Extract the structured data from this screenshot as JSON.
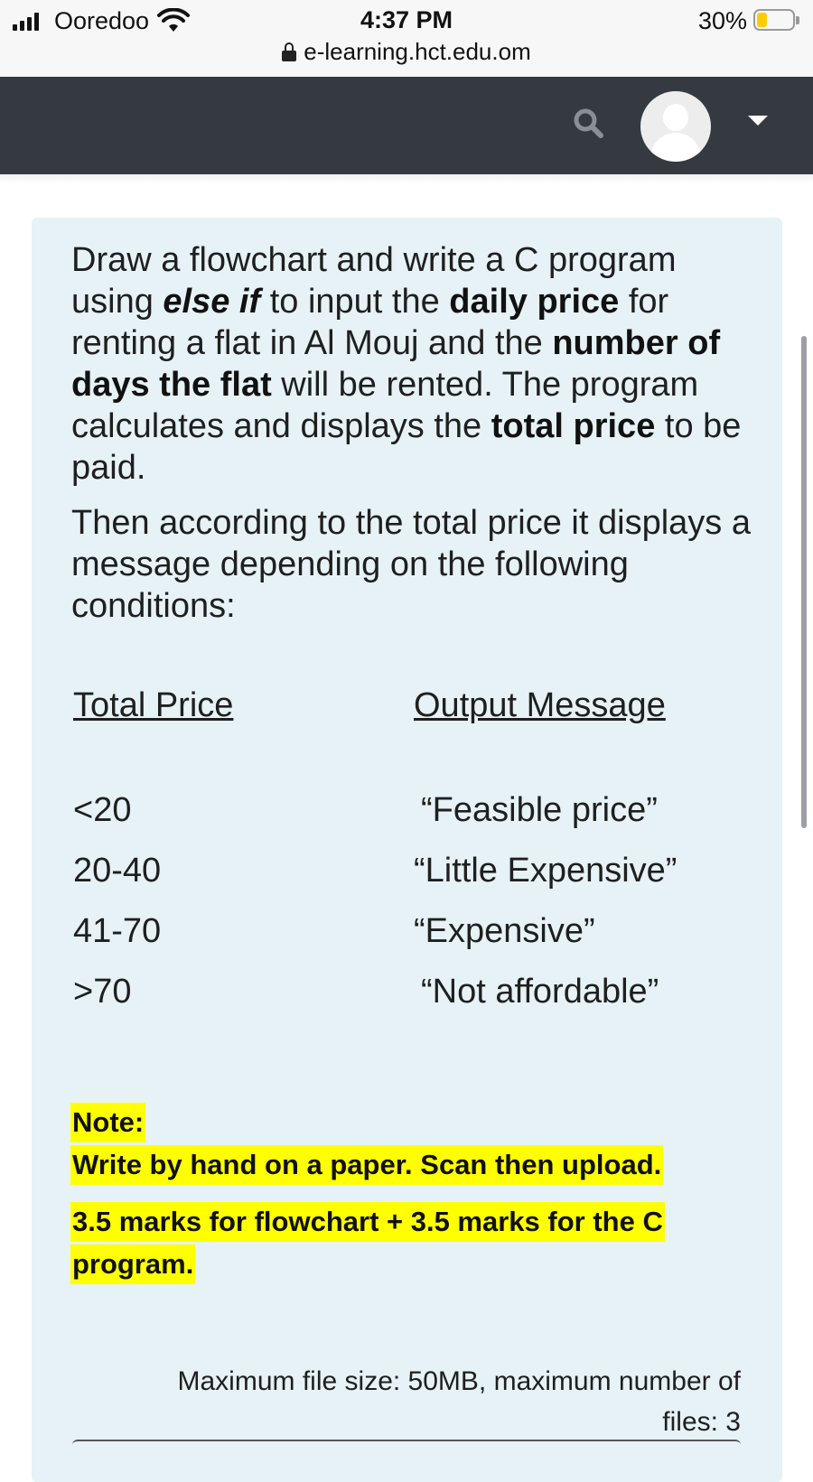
{
  "status_bar": {
    "carrier": "Ooredoo",
    "time": "4:37 PM",
    "battery_percent": "30%",
    "battery_level": 0.3,
    "url": "e-learning.hct.edu.om"
  },
  "navbar": {
    "background": "#343a40",
    "icons": [
      "search-icon",
      "user-avatar",
      "chevron-down-icon"
    ]
  },
  "question": {
    "paragraph1": {
      "t1": "Draw a flowchart and write a C program using ",
      "b1": "else if",
      "t2": " to input the ",
      "b2": "daily price",
      "t3": " for renting a flat in Al Mouj and the ",
      "b3": "number of days the flat",
      "t4": " will be rented. The program calculates and displays the ",
      "b4": "total price",
      "t5": " to be paid."
    },
    "paragraph2": "Then according to the total price it displays a message depending on the following conditions:",
    "table": {
      "headers": {
        "price": "Total Price ",
        "message": "Output Message "
      },
      "rows": [
        {
          "price": "<20",
          "message": "“Feasible price”"
        },
        {
          "price": "20-40",
          "message": "“Little Expensive”"
        },
        {
          "price": "41-70",
          "message": "“Expensive”"
        },
        {
          "price": ">70",
          "message": "“Not affordable”"
        }
      ]
    },
    "note": {
      "label": "Note:",
      "line1": "Write by hand on a paper. Scan then upload.",
      "marks_line1": "3.5 marks for flowchart + 3.5 marks for the C",
      "marks_line2": "program."
    },
    "highlight_color": "#ffff00"
  },
  "upload": {
    "limits_line1": "Maximum file size: 50MB, maximum number of",
    "limits_line2": "files: 3"
  }
}
